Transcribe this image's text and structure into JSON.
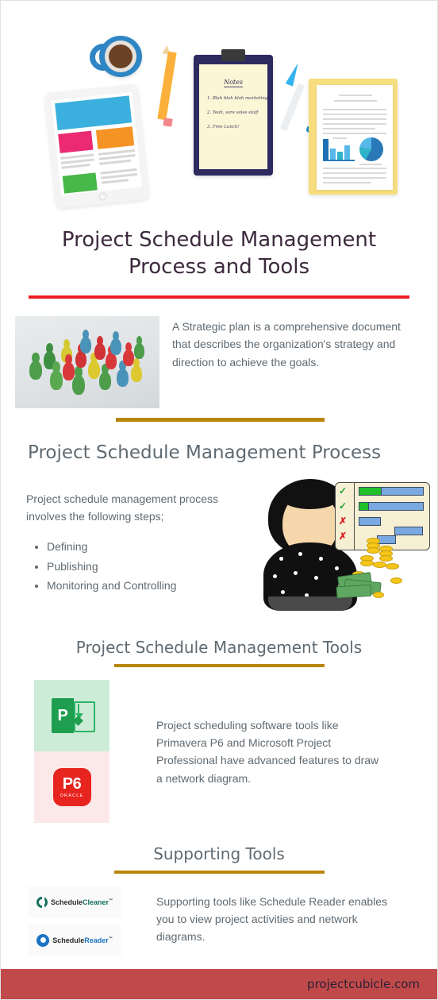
{
  "hero": {
    "clipboard": {
      "title": "Notes",
      "items": [
        "1. Blah blah blah marketing",
        "2. Yeah, sore sales stuff",
        "3. Free Lunch!"
      ]
    },
    "icons": {
      "tablet": "tablet-icon",
      "coffee": "coffee-cup-icon",
      "pencil": "pencil-icon",
      "clipboard": "clipboard-icon",
      "pen": "pen-icon",
      "folder": "document-folder-icon"
    }
  },
  "title": {
    "main": "Project Schedule Management Process and Tools"
  },
  "intro": {
    "image_alt": "colored-pawns-photo",
    "text": "A Strategic plan is a comprehensive document that describes the organization's strategy and direction to achieve the goals."
  },
  "process": {
    "heading": "Project Schedule Management Process",
    "text": "Project schedule management process involves the following steps;",
    "steps": [
      "Defining",
      "Publishing",
      "Monitoring and Controlling"
    ],
    "art_alt": "person-gantt-chart-money-illustration"
  },
  "tools": {
    "heading": "Project Schedule Management Tools",
    "text": "Project scheduling software tools like Primavera P6 and Microsoft Project Professional have advanced features to draw a network diagram.",
    "logos": [
      {
        "name": "microsoft-project-logo",
        "letter": "P"
      },
      {
        "name": "oracle-p6-logo",
        "main": "P6",
        "sub": "ORACLE"
      }
    ]
  },
  "supporting": {
    "heading": "Supporting Tools",
    "text": "Supporting tools like Schedule Reader enables you to view project activities and network diagrams.",
    "logos": [
      {
        "name": "schedulecleaner-logo",
        "bold": "Schedule",
        "accent": "Cleaner"
      },
      {
        "name": "schedulereader-logo",
        "bold": "Schedule",
        "accent": "Reader"
      }
    ]
  },
  "footer": {
    "site": "projectcubicle.com"
  },
  "colors": {
    "title_text": "#3d2a3e",
    "body_text": "#5f6a72",
    "rule_red": "#ed1c24",
    "rule_gold": "#b8860b",
    "footer_bg": "#bf4a49",
    "ms_project_green": "#1f9e4f",
    "oracle_red": "#e8241f",
    "cleaner_teal": "#13705f",
    "reader_blue": "#1a73c4"
  }
}
